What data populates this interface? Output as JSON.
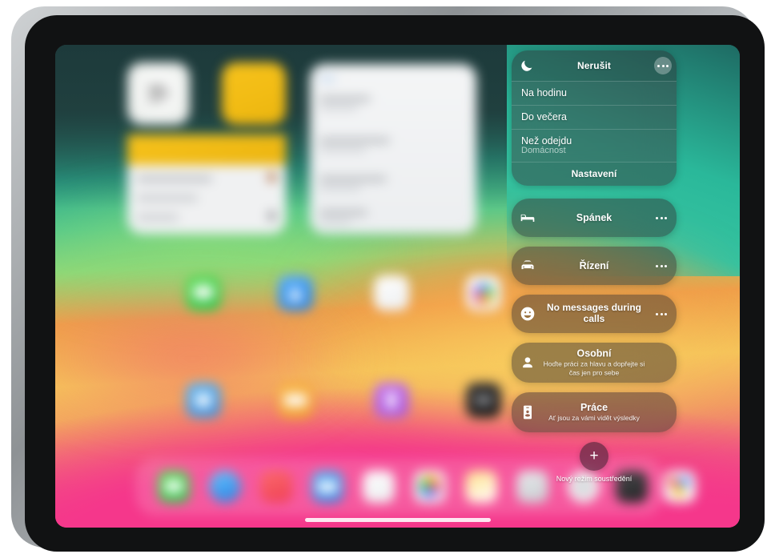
{
  "device": {
    "name": "ipad"
  },
  "focus_panel": {
    "dnd": {
      "icon": "moon-icon",
      "title": "Nerušit",
      "more_icon": "ellipsis-icon",
      "options": [
        {
          "label": "Na hodinu",
          "sublabel": ""
        },
        {
          "label": "Do večera",
          "sublabel": ""
        },
        {
          "label": "Než odejdu",
          "sublabel": "Domácnost"
        }
      ],
      "settings_label": "Nastavení"
    },
    "modes": [
      {
        "icon": "bed-icon",
        "title": "Spánek",
        "subtitle": "",
        "has_more": true
      },
      {
        "icon": "car-icon",
        "title": "Řízení",
        "subtitle": "",
        "has_more": true
      },
      {
        "icon": "smiley-icon",
        "title": "No messages during calls",
        "subtitle": "",
        "has_more": true,
        "two_line": true
      },
      {
        "icon": "person-icon",
        "title": "Osobní",
        "subtitle": "Hoďte práci za hlavu a dopřejte si čas jen pro sebe",
        "has_more": false
      },
      {
        "icon": "badge-icon",
        "title": "Práce",
        "subtitle": "Ať jsou za vámi vidět výsledky",
        "has_more": false
      }
    ],
    "add": {
      "icon": "plus-icon",
      "label": "Nový režim soustředění"
    }
  },
  "colors": {
    "pill_bg": "#302c30",
    "accent_pink": "#f5378b",
    "accent_teal": "#2ab89a",
    "text": "#ffffff"
  }
}
